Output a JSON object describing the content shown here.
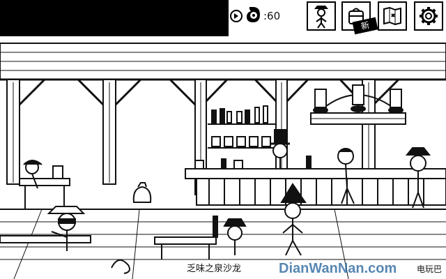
{
  "hud": {
    "timer_value": ":60",
    "play_icon": "play-icon",
    "clock_icon": "stopwatch-icon",
    "buttons": [
      {
        "name": "character-button",
        "icon": "cowboy-figure-icon"
      },
      {
        "name": "inventory-button",
        "icon": "backpack-icon",
        "badge": "新"
      },
      {
        "name": "map-button",
        "icon": "treasure-map-icon"
      },
      {
        "name": "settings-button",
        "icon": "gear-icon"
      }
    ]
  },
  "scene": {
    "location_name": "乏味之泉沙龙",
    "partial_text": "电玩巴"
  },
  "watermark": {
    "text": "DianWanNan.com"
  },
  "colors": {
    "ink": "#111111",
    "paper": "#ffffff",
    "hud_bar": "#000000"
  }
}
